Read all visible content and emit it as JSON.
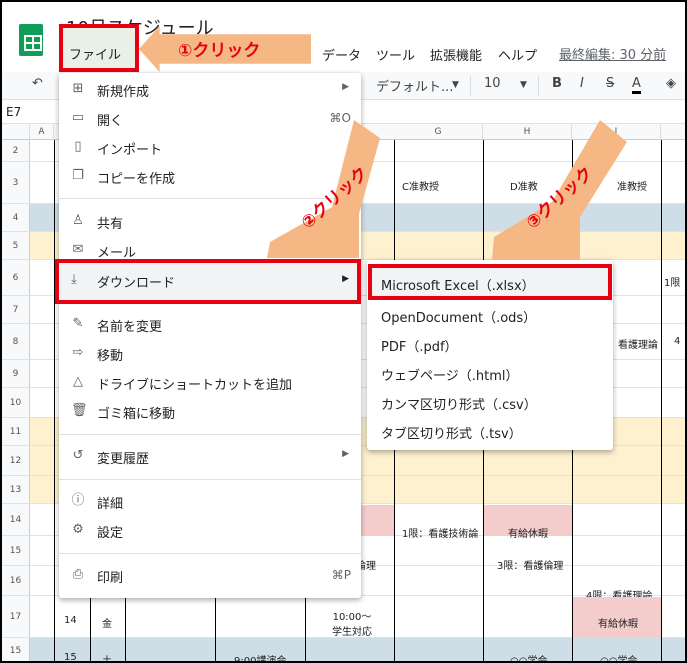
{
  "header": {
    "doc_title": "10月スケジュール",
    "last_edit": "最終編集: 30 分前"
  },
  "menubar": {
    "file": "ファイル",
    "data": "データ",
    "tools": "ツール",
    "extensions": "拡張機能",
    "help": "ヘルプ"
  },
  "toolbar": {
    "font": "デフォルト...",
    "font_size": "10",
    "bold": "B",
    "italic": "I",
    "strike": "S",
    "text_color": "A"
  },
  "namebox": "E7",
  "columns": [
    "A",
    "G",
    "H",
    "I"
  ],
  "rows": [
    "2",
    "3",
    "4",
    "5",
    "6",
    "7",
    "8",
    "9",
    "10",
    "11",
    "12",
    "13",
    "14",
    "15",
    "16",
    "17",
    "15"
  ],
  "cells": {
    "c_teacher": "C准教授",
    "d_teacher": "D准教",
    "e_teacher": "准教授",
    "nursing_theory": "看護理論",
    "period1": "1限",
    "period4": "4",
    "tech_theory": "1限：看護技術論",
    "paid_leave_h": "有給休暇",
    "ethics": "倫理",
    "ethics2": "3限：看護倫理",
    "nursing_theory2": "4限：看護理論",
    "day14": "14",
    "weekday_fri": "金",
    "student_support": "10:00～\n学生対応",
    "paid_leave_i": "有給休暇",
    "day15": "15",
    "weekday_sat": "土",
    "lecture": "9:00講演会",
    "conf_h": "○○学会",
    "conf_i": "○○学会"
  },
  "file_menu": [
    {
      "label": "新規作成",
      "icon": "plus-box-icon",
      "submenu": true
    },
    {
      "label": "開く",
      "icon": "folder-icon",
      "shortcut": "⌘O"
    },
    {
      "label": "インポート",
      "icon": "document-icon"
    },
    {
      "label": "コピーを作成",
      "icon": "copy-icon"
    },
    {
      "label": "共有",
      "icon": "person-add-icon"
    },
    {
      "label": "メール",
      "icon": "mail-icon",
      "submenu": true
    },
    {
      "label": "ダウンロード",
      "icon": "download-icon",
      "submenu": true
    },
    {
      "label": "名前を変更",
      "icon": "rename-icon"
    },
    {
      "label": "移動",
      "icon": "move-icon"
    },
    {
      "label": "ドライブにショートカットを追加",
      "icon": "drive-shortcut-icon"
    },
    {
      "label": "ゴミ箱に移動",
      "icon": "trash-icon"
    },
    {
      "label": "変更履歴",
      "icon": "history-icon",
      "submenu": true
    },
    {
      "label": "詳細",
      "icon": "info-icon"
    },
    {
      "label": "設定",
      "icon": "gear-icon"
    },
    {
      "label": "印刷",
      "icon": "print-icon",
      "shortcut": "⌘P"
    }
  ],
  "download_submenu": [
    "Microsoft Excel（.xlsx）",
    "OpenDocument（.ods）",
    "PDF（.pdf）",
    "ウェブページ（.html）",
    "カンマ区切り形式（.csv）",
    "タブ区切り形式（.tsv）"
  ],
  "callouts": {
    "step1": "①クリック",
    "step2": "②クリック",
    "step3": "③クリック"
  },
  "colors": {
    "highlight_red": "#e60012",
    "arrow_orange": "#f5b784",
    "sheets_green": "#0f9d58"
  }
}
